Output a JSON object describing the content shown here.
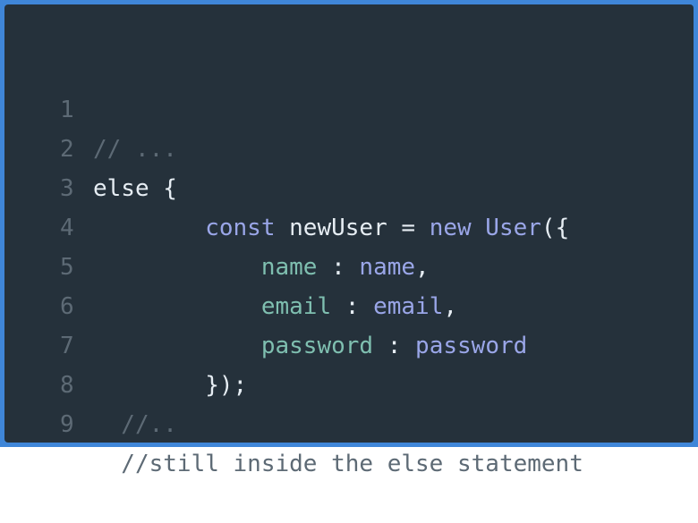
{
  "editor": {
    "colors": {
      "border": "#3f86d8",
      "background": "#25313b",
      "comment": "#5d6a75",
      "plain": "#e6edf3",
      "keyword": "#9aa6e8",
      "property": "#7fbfb0"
    },
    "lines": [
      {
        "number": "1",
        "segments": [
          {
            "text": "// ...",
            "kind": "comment"
          }
        ]
      },
      {
        "number": "2",
        "segments": [
          {
            "text": "else {",
            "kind": "plain"
          }
        ]
      },
      {
        "number": "3",
        "segments": [
          {
            "text": "        const",
            "kind": "keyword"
          },
          {
            "text": " newUser = ",
            "kind": "plain"
          },
          {
            "text": "new User",
            "kind": "keyword"
          },
          {
            "text": "({",
            "kind": "plain"
          }
        ]
      },
      {
        "number": "4",
        "segments": [
          {
            "text": "            name",
            "kind": "prop"
          },
          {
            "text": " : ",
            "kind": "plain"
          },
          {
            "text": "name",
            "kind": "keyword"
          },
          {
            "text": ",",
            "kind": "plain"
          }
        ]
      },
      {
        "number": "5",
        "segments": [
          {
            "text": "            email",
            "kind": "prop"
          },
          {
            "text": " : ",
            "kind": "plain"
          },
          {
            "text": "email",
            "kind": "keyword"
          },
          {
            "text": ",",
            "kind": "plain"
          }
        ]
      },
      {
        "number": "6",
        "segments": [
          {
            "text": "            password",
            "kind": "prop"
          },
          {
            "text": " : ",
            "kind": "plain"
          },
          {
            "text": "password",
            "kind": "keyword"
          }
        ]
      },
      {
        "number": "7",
        "segments": [
          {
            "text": "        });",
            "kind": "plain"
          }
        ]
      },
      {
        "number": "8",
        "segments": [
          {
            "text": "  //..",
            "kind": "comment"
          }
        ]
      },
      {
        "number": "9",
        "segments": [
          {
            "text": "  //still inside the else statement",
            "kind": "comment"
          }
        ]
      }
    ]
  }
}
